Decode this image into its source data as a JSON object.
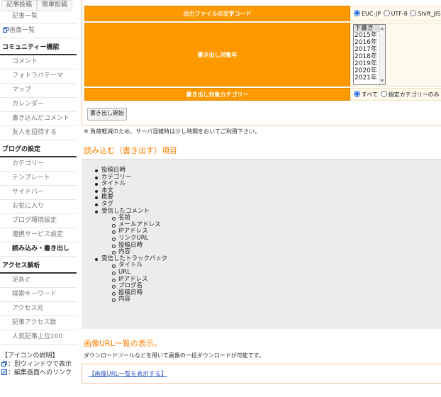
{
  "sidebar": {
    "top_buttons": [
      "記事投稿",
      "簡単投稿"
    ],
    "group1": [
      {
        "label": "記事一覧",
        "icon": false
      },
      {
        "label": "画像一覧",
        "icon": true
      }
    ],
    "community_title": "コミュニティー機能",
    "community": [
      "コメント",
      "フォトラバテーマ",
      "マップ",
      "カレンダー",
      "書き込んだコメント",
      "友人を招待する"
    ],
    "blog_title": "ブログの設定",
    "blog": [
      "カテゴリー",
      "テンプレート",
      "サイドバー",
      "お気に入り",
      "ブログ環境設定",
      "連携サービス設定",
      "読み込み・書き出し"
    ],
    "access_title": "アクセス解析",
    "access": [
      "足あと",
      "検索キーワード",
      "アクセス元",
      "記事アクセス数",
      "人気記事上位100"
    ],
    "legend_title": "【アイコンの説明】",
    "legend_new_window": "：別ウィンドウで表示",
    "legend_edit_link": "：編集画面へのリンク"
  },
  "form": {
    "encoding_label": "出力ファイルの文字コード",
    "encoding_options": [
      "EUC-JP",
      "UTF-8",
      "Shift_JIS"
    ],
    "year_label": "書き出し対象年",
    "year_options": [
      "下書き",
      "2015年",
      "2016年",
      "2017年",
      "2018年",
      "2019年",
      "2020年",
      "2021年"
    ],
    "category_label": "書き出し対象カテゴリー",
    "category_options": [
      "すべて",
      "指定カテゴリーのみ"
    ],
    "start_button": "書き出し開始"
  },
  "note": "※ 負荷軽減のため、サーバ混雑時は少し時間をおいてご利用下さい。",
  "items_title": "読み込む（書き出す）項目",
  "items": {
    "basic": [
      "投稿日時",
      "カテゴリー",
      "タイトル",
      "本文",
      "概要",
      "タグ"
    ],
    "comment": {
      "label": "受信したコメント",
      "sub": [
        "名前",
        "メールアドレス",
        "IPアドレス",
        "リンクURL",
        "投稿日時",
        "内容"
      ]
    },
    "trackback": {
      "label": "受信したトラックバック",
      "sub": [
        "タイトル",
        "URL",
        "IPアドレス",
        "ブログ名",
        "投稿日時",
        "内容"
      ]
    }
  },
  "image_title": "画像URL一覧の表示。",
  "image_desc": "ダウンロードツールなどを用いて画像の一括ダウンロードが可能です。",
  "image_link": "【画像URL一覧を表示する】",
  "colors": {
    "accent": "#ff9900",
    "title": "#ff8000",
    "link": "#3355cc"
  }
}
